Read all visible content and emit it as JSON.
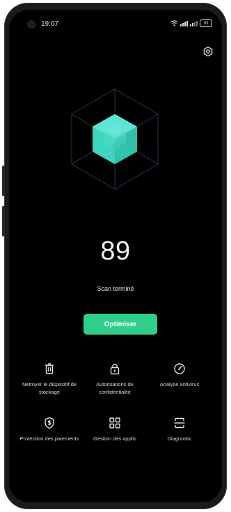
{
  "status_bar": {
    "time": "19:07",
    "battery": "93"
  },
  "scan": {
    "score": "89",
    "status": "Scan terminé"
  },
  "actions": {
    "optimize_label": "Optimiser"
  },
  "tools": [
    {
      "label": "Nettoyer le dispositif de stockage",
      "icon": "trash-icon"
    },
    {
      "label": "Autorisations de confidentialité",
      "icon": "lock-icon"
    },
    {
      "label": "Analyse antivirus",
      "icon": "speedometer-icon"
    },
    {
      "label": "Protection des paiements",
      "icon": "dollar-shield-icon"
    },
    {
      "label": "Gestion des applis",
      "icon": "app-grid-icon"
    },
    {
      "label": "Diagnostic",
      "icon": "diagnostic-icon"
    }
  ],
  "colors": {
    "accent": "#2ecf8a",
    "cube": "#3fd6c0",
    "background": "#000000"
  }
}
